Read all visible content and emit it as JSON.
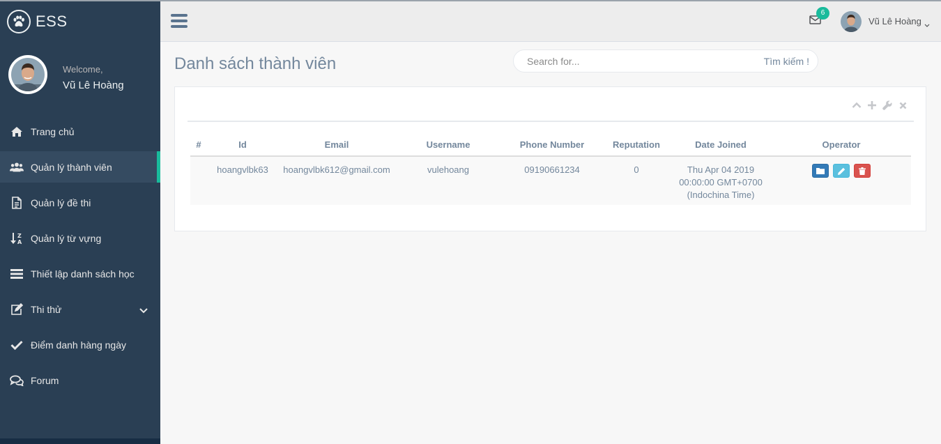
{
  "brand": {
    "name": "ESS",
    "logo_icon": "paw-icon"
  },
  "profile": {
    "welcome": "Welcome,",
    "name": "Vũ Lê Hoàng"
  },
  "sidebar": {
    "items": [
      {
        "label": "Trang chủ",
        "icon": "home-icon",
        "active": false
      },
      {
        "label": "Quản lý thành viên",
        "icon": "users-icon",
        "active": true
      },
      {
        "label": "Quản lý đề thi",
        "icon": "document-icon",
        "active": false
      },
      {
        "label": "Quản lý từ vựng",
        "icon": "sort-alpha-icon",
        "active": false
      },
      {
        "label": "Thiết lập danh sách học",
        "icon": "list-icon",
        "active": false
      },
      {
        "label": "Thi thử",
        "icon": "edit-icon",
        "active": false,
        "has_submenu": true
      },
      {
        "label": "Điểm danh hàng ngày",
        "icon": "check-icon",
        "active": false
      },
      {
        "label": "Forum",
        "icon": "comments-icon",
        "active": false
      }
    ]
  },
  "topnav": {
    "mail_badge": "6",
    "user_name": "Vũ Lê Hoàng"
  },
  "page": {
    "title": "Danh sách thành viên"
  },
  "search": {
    "placeholder": "Search for...",
    "button_label": "Tìm kiếm !"
  },
  "table": {
    "headers": [
      "#",
      "Id",
      "Email",
      "Username",
      "Phone Number",
      "Reputation",
      "Date Joined",
      "Operator"
    ],
    "rows": [
      {
        "index": "",
        "id": "hoangvlbk63",
        "email": "hoangvlbk612@gmail.com",
        "username": "vulehoang",
        "phone": "09190661234",
        "reputation": "0",
        "date_joined_line1": "Thu Apr 04 2019",
        "date_joined_line2": "00:00:00 GMT+0700",
        "date_joined_line3": "(Indochina Time)"
      }
    ]
  },
  "colors": {
    "sidebar_bg": "#2A3F54",
    "accent": "#1ABB9C",
    "text_muted": "#73879C",
    "btn_primary": "#337AB7",
    "btn_info": "#5BC0DE",
    "btn_danger": "#D9534F"
  }
}
